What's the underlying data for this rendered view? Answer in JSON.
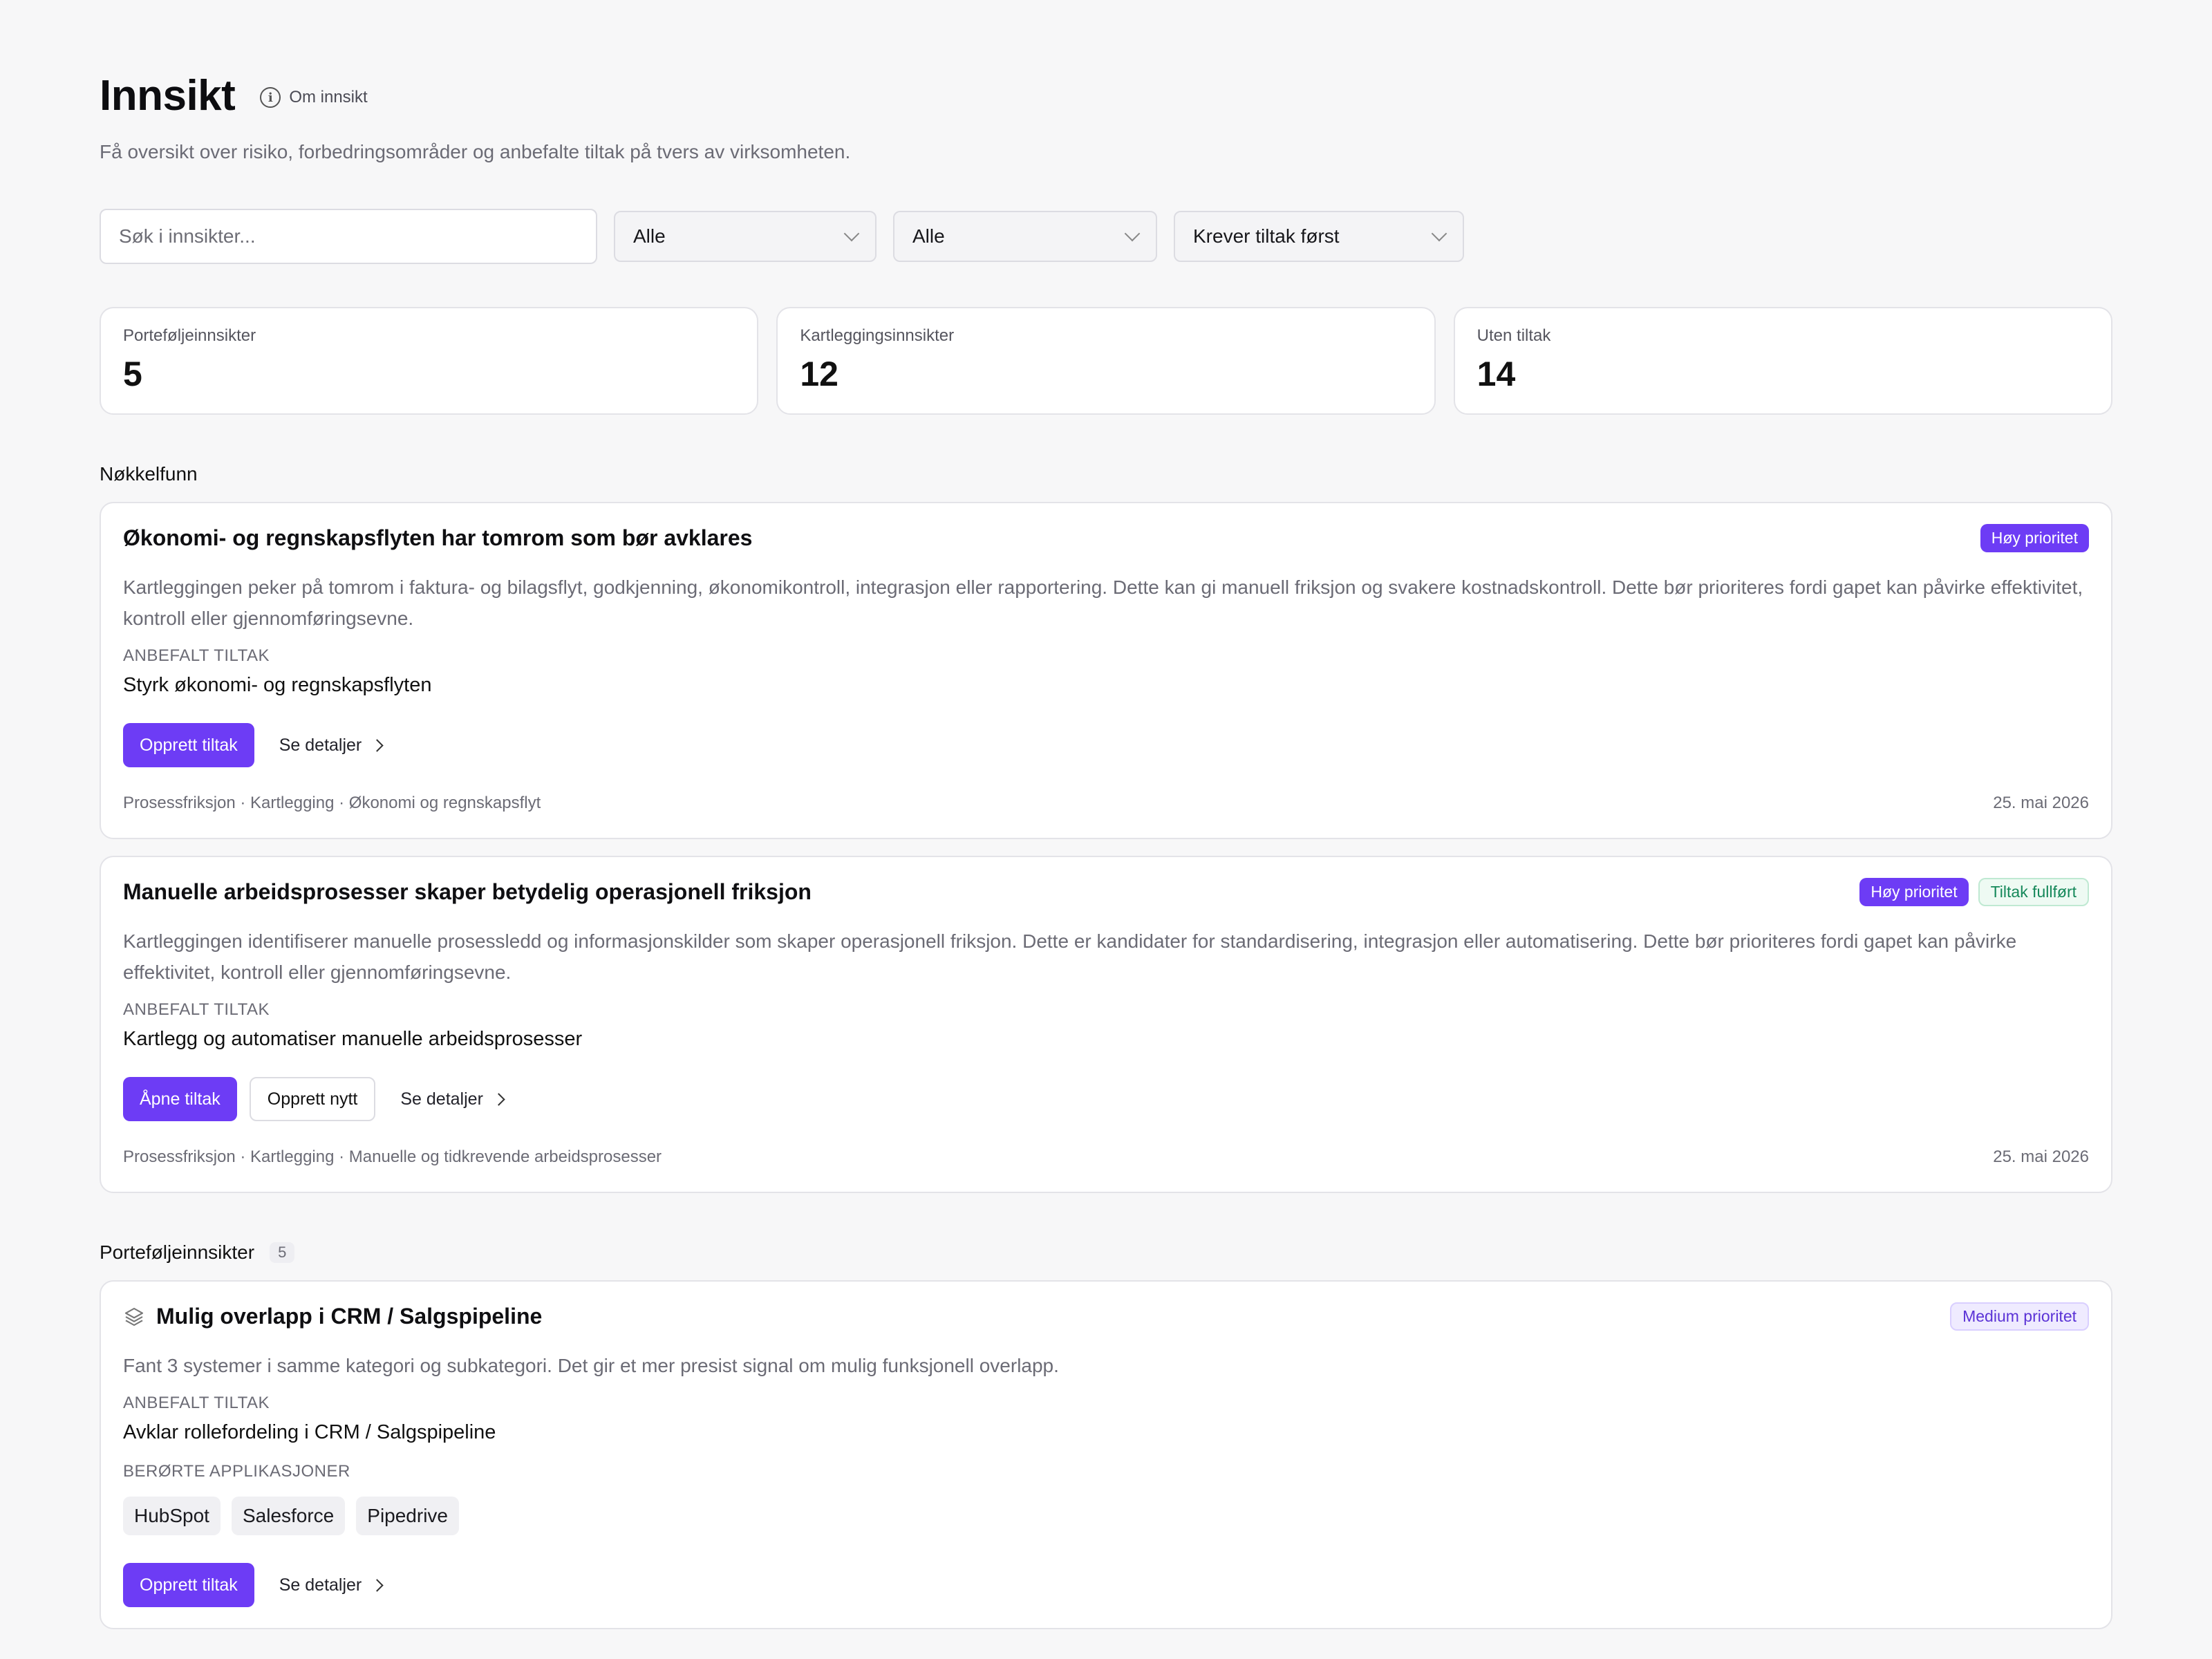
{
  "header": {
    "title": "Innsikt",
    "about_label": "Om innsikt",
    "subtitle": "Få oversikt over risiko, forbedringsområder og anbefalte tiltak på tvers av virksomheten."
  },
  "filters": {
    "search_placeholder": "Søk i innsikter...",
    "select1_value": "Alle",
    "select2_value": "Alle",
    "sort_value": "Krever tiltak først"
  },
  "stats": [
    {
      "label": "Porteføljeinnsikter",
      "value": "5"
    },
    {
      "label": "Kartleggingsinnsikter",
      "value": "12"
    },
    {
      "label": "Uten tiltak",
      "value": "14"
    }
  ],
  "key_findings": {
    "title": "Nøkkelfunn",
    "cards": [
      {
        "title": "Økonomi- og regnskapsflyten har tomrom som bør avklares",
        "badge_high": "Høy prioritet",
        "description": "Kartleggingen peker på tomrom i faktura- og bilagsflyt, godkjenning, økonomikontroll, integrasjon eller rapportering. Dette kan gi manuell friksjon og svakere kostnadskontroll. Dette bør prioriteres fordi gapet kan påvirke effektivitet, kontroll eller gjennomføringsevne.",
        "action_label": "ANBEFALT TILTAK",
        "action": "Styrk økonomi- og regnskapsflyten",
        "primary_button": "Opprett tiltak",
        "details_link": "Se detaljer",
        "meta": "Prosessfriksjon · Kartlegging · Økonomi og regnskapsflyt",
        "date": "25. mai 2026"
      },
      {
        "title": "Manuelle arbeidsprosesser skaper betydelig operasjonell friksjon",
        "badge_high": "Høy prioritet",
        "badge_done": "Tiltak fullført",
        "description": "Kartleggingen identifiserer manuelle prosessledd og informasjonskilder som skaper operasjonell friksjon. Dette er kandidater for standardisering, integrasjon eller automatisering. Dette bør prioriteres fordi gapet kan påvirke effektivitet, kontroll eller gjennomføringsevne.",
        "action_label": "ANBEFALT TILTAK",
        "action": "Kartlegg og automatiser manuelle arbeidsprosesser",
        "primary_button": "Åpne tiltak",
        "secondary_button": "Opprett nytt",
        "details_link": "Se detaljer",
        "meta": "Prosessfriksjon · Kartlegging · Manuelle og tidkrevende arbeidsprosesser",
        "date": "25. mai 2026"
      }
    ]
  },
  "portfolio": {
    "title": "Porteføljeinnsikter",
    "count": "5",
    "cards": [
      {
        "title": "Mulig overlapp i CRM / Salgspipeline",
        "icon": "layers-icon",
        "badge_medium": "Medium prioritet",
        "description": "Fant 3 systemer i samme kategori og subkategori. Det gir et mer presist signal om mulig funksjonell overlapp.",
        "action_label": "ANBEFALT TILTAK",
        "action": "Avklar rollefordeling i CRM / Salgspipeline",
        "apps_label": "BERØRTE APPLIKASJONER",
        "apps": [
          "HubSpot",
          "Salesforce",
          "Pipedrive"
        ],
        "primary_button": "Opprett tiltak",
        "details_link": "Se detaljer"
      }
    ]
  },
  "colors": {
    "accent": "#6d3cf5",
    "success": "#15885a",
    "background": "#f7f7f8"
  }
}
